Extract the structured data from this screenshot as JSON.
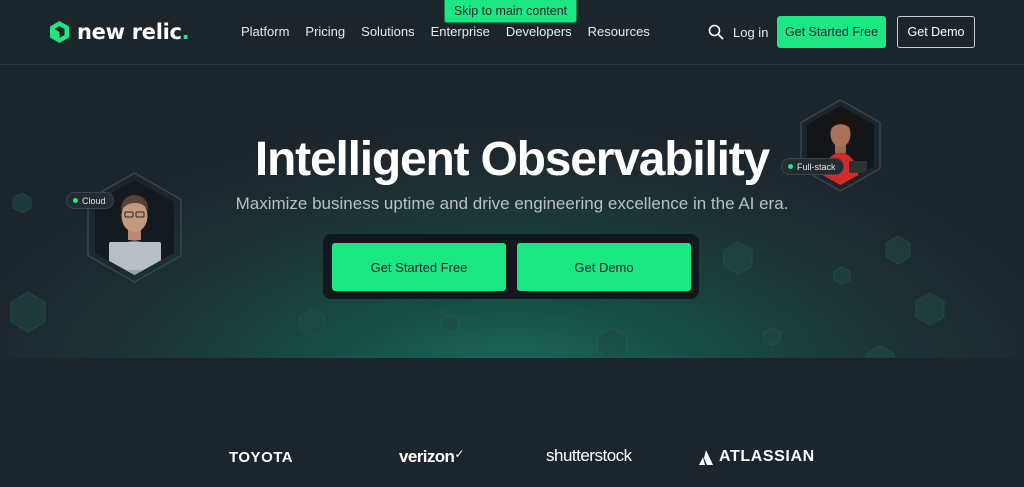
{
  "header": {
    "logo_text": "new relic",
    "logo_dot": ".",
    "skip_link": "Skip to main content",
    "nav": [
      "Platform",
      "Pricing",
      "Solutions",
      "Enterprise",
      "Developers",
      "Resources"
    ],
    "login": "Log in",
    "get_started": "Get Started Free",
    "get_demo": "Get Demo"
  },
  "hero": {
    "title": "Intelligent Observability",
    "subtitle": "Maximize business uptime and drive engineering excellence in the AI era.",
    "cta_started": "Get Started Free",
    "cta_demo": "Get Demo",
    "tag_left": "Cloud",
    "tag_right": "Full-stack"
  },
  "brands": [
    "TOYOTA",
    "verizon",
    "shutterstock",
    "ATLASSIAN"
  ],
  "colors": {
    "accent": "#1ce783",
    "background": "#1d252c",
    "teal_glow": "#1d6d5c"
  }
}
